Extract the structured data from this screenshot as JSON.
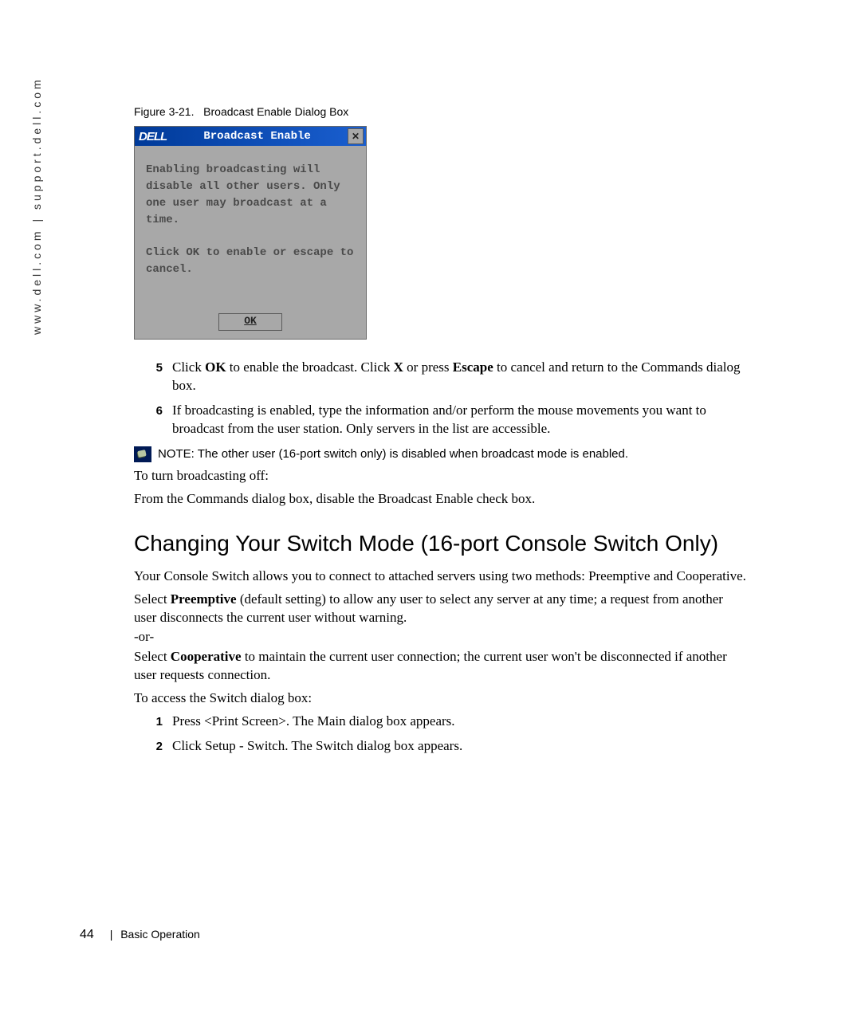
{
  "sidebar": {
    "url": "www.dell.com | support.dell.com"
  },
  "figure": {
    "label": "Figure 3-21.",
    "title": "Broadcast Enable Dialog Box"
  },
  "dialog": {
    "logo": "DELL",
    "title": "Broadcast Enable",
    "close_glyph": "✕",
    "msg1": "Enabling broadcasting will disable all other users. Only one user may broadcast at a time.",
    "msg2": "Click OK to enable or escape to cancel.",
    "ok_label": "OK"
  },
  "steps_a": [
    {
      "num": "5",
      "pre": "Click ",
      "b1": "OK",
      "mid": " to enable the broadcast. Click ",
      "b2": "X",
      "mid2": " or press ",
      "b3": "Escape",
      "post": " to cancel and return to the Commands dialog box."
    },
    {
      "num": "6",
      "text": "If broadcasting is enabled, type the information and/or perform the mouse movements you want to broadcast from the user station. Only servers in the list are accessible."
    }
  ],
  "note": {
    "label": "NOTE:",
    "text": " The other user (16-port switch only) is disabled when broadcast mode is enabled."
  },
  "turn_off": "To turn broadcasting off:",
  "from_commands": "From the Commands dialog box, disable the Broadcast Enable check box.",
  "heading": "Changing Your Switch Mode (16-port Console Switch Only)",
  "p1": "Your Console Switch allows you to connect to attached servers using two methods: Preemptive and Cooperative.",
  "p2": {
    "pre": "Select ",
    "b": "Preemptive",
    "post": " (default setting) to allow any user to select any server at any time; a request from another user disconnects the current user without warning."
  },
  "or": " -or-",
  "p3": {
    "pre": "Select ",
    "b": "Cooperative",
    "post": " to maintain the current user connection; the current user won't be disconnected if another user requests connection."
  },
  "access": "To access the Switch dialog box:",
  "steps_b": [
    {
      "num": "1",
      "text": "Press <Print Screen>. The Main dialog box appears."
    },
    {
      "num": "2",
      "text": "Click Setup - Switch. The Switch dialog box appears."
    }
  ],
  "footer": {
    "page": "44",
    "sep": "|",
    "section": "Basic Operation"
  }
}
